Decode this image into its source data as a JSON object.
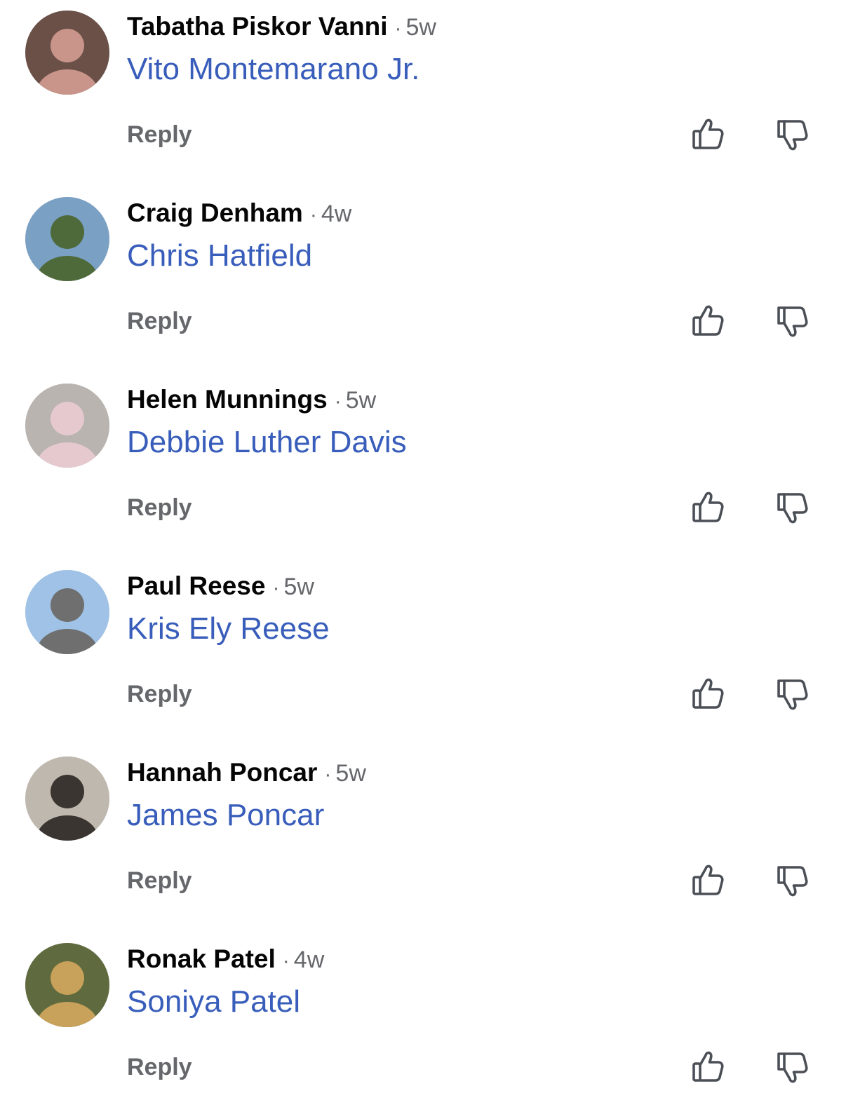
{
  "comments": [
    {
      "author": "Tabatha Piskor Vanni",
      "separator": "·",
      "age": "5w",
      "mention": "Vito Montemarano Jr.",
      "reply_label": "Reply",
      "avatar_colors": [
        "#6b5048",
        "#c9958a"
      ]
    },
    {
      "author": "Craig Denham",
      "separator": "·",
      "age": "4w",
      "mention": "Chris Hatfield",
      "reply_label": "Reply",
      "avatar_colors": [
        "#7aa0c4",
        "#4f6a3a"
      ]
    },
    {
      "author": "Helen Munnings",
      "separator": "·",
      "age": "5w",
      "mention": "Debbie Luther Davis",
      "reply_label": "Reply",
      "avatar_colors": [
        "#b9b4b0",
        "#e6c9cf"
      ]
    },
    {
      "author": "Paul Reese",
      "separator": "·",
      "age": "5w",
      "mention": "Kris Ely Reese",
      "reply_label": "Reply",
      "avatar_colors": [
        "#9fc2e6",
        "#6f6f6f"
      ]
    },
    {
      "author": "Hannah Poncar",
      "separator": "·",
      "age": "5w",
      "mention": "James Poncar",
      "reply_label": "Reply",
      "avatar_colors": [
        "#bfb8ae",
        "#3a3531"
      ]
    },
    {
      "author": "Ronak Patel",
      "separator": "·",
      "age": "4w",
      "mention": "Soniya Patel",
      "reply_label": "Reply",
      "avatar_colors": [
        "#5f6b3e",
        "#c8a15a"
      ]
    }
  ],
  "icons": {
    "upvote": "thumbs-up-icon",
    "downvote": "thumbs-down-icon"
  },
  "colors": {
    "mention": "#385dba",
    "meta": "#65676b",
    "author": "#050505"
  }
}
